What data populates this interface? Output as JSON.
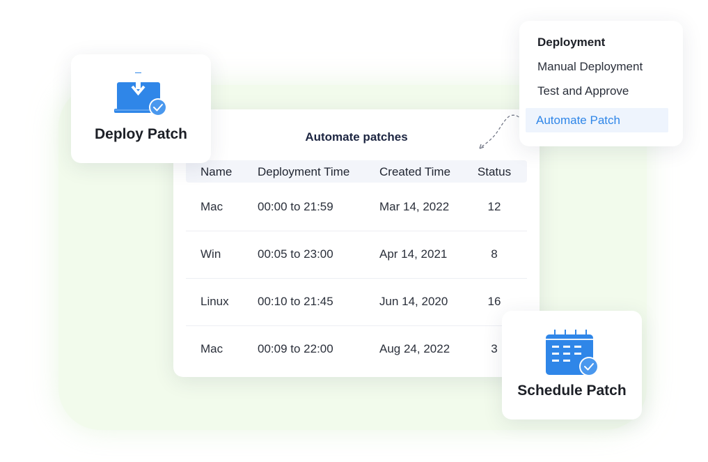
{
  "table": {
    "title": "Automate patches",
    "headers": {
      "name": "Name",
      "deployment_time": "Deployment Time",
      "created_time": "Created Time",
      "status": "Status"
    },
    "rows": [
      {
        "name": "Mac",
        "deployment_time": "00:00 to 21:59",
        "created_time": "Mar 14, 2022",
        "status": "12"
      },
      {
        "name": "Win",
        "deployment_time": "00:05 to 23:00",
        "created_time": "Apr 14, 2021",
        "status": "8"
      },
      {
        "name": "Linux",
        "deployment_time": "00:10 to 21:45",
        "created_time": "Jun 14, 2020",
        "status": "16"
      },
      {
        "name": "Mac",
        "deployment_time": "00:09 to 22:00",
        "created_time": "Aug 24, 2022",
        "status": "3"
      }
    ]
  },
  "deploy_card": {
    "label": "Deploy Patch",
    "icon": "laptop-download-icon"
  },
  "schedule_card": {
    "label": "Schedule Patch",
    "icon": "calendar-check-icon"
  },
  "menu": {
    "title": "Deployment",
    "items": [
      {
        "label": "Manual Deployment",
        "active": false
      },
      {
        "label": "Test and Approve",
        "active": false
      },
      {
        "label": "Automate Patch",
        "active": true
      }
    ]
  },
  "colors": {
    "accent": "#2f86e8",
    "panel_bg": "#f2fbec",
    "header_bg": "#f3f5fa",
    "active_bg": "#eef4fd"
  }
}
